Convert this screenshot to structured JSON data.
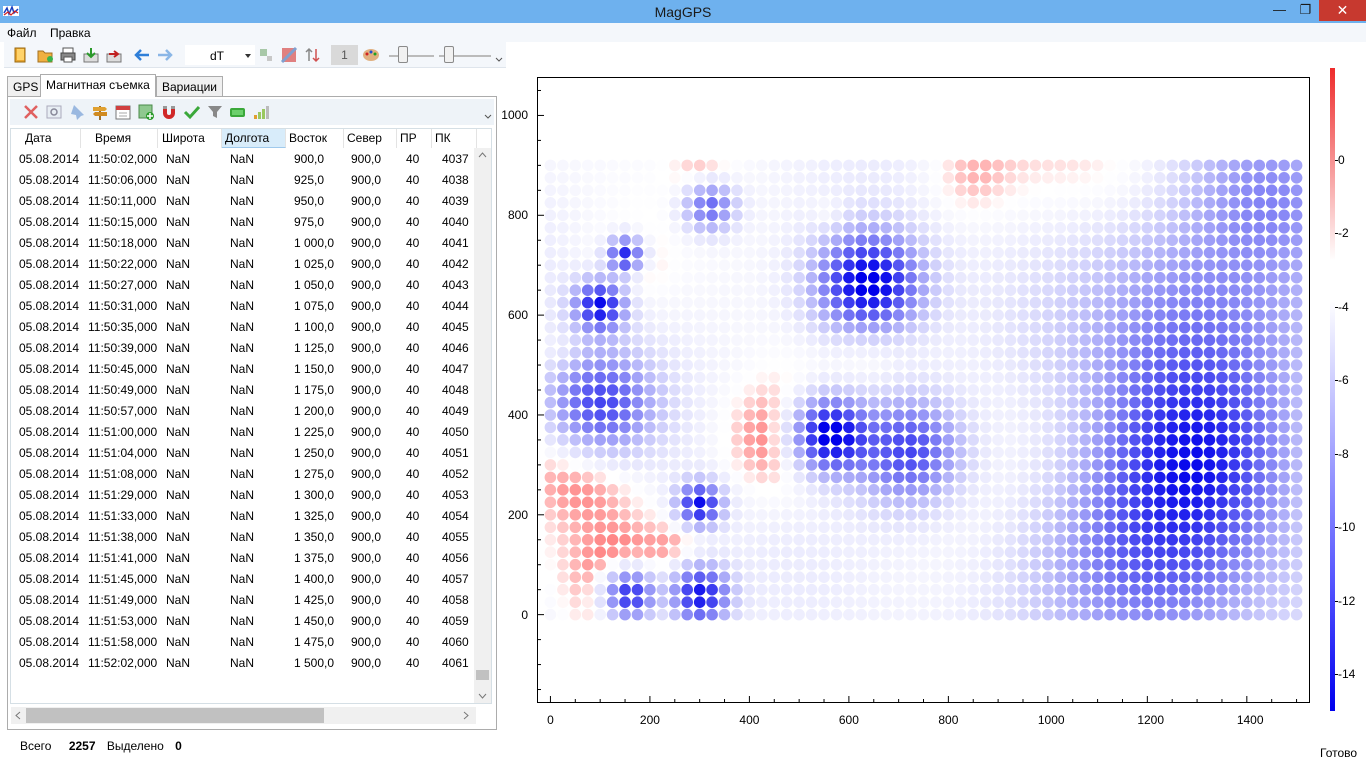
{
  "window": {
    "title": "MagGPS",
    "minimize_glyph": "—",
    "maximize_glyph": "❐",
    "close_glyph": "✕"
  },
  "menu": [
    "Файл",
    "Правка"
  ],
  "toolbar": {
    "channel_value": "dT",
    "number_value": "1"
  },
  "tabs": [
    "GPS",
    "Магнитная съемка",
    "Вариации"
  ],
  "table": {
    "columns": [
      "Дата",
      "Время",
      "Широта",
      "Долгота",
      "Восток",
      "Север",
      "ПР",
      "ПК"
    ],
    "rows": [
      [
        "05.08.2014",
        "11:50:02,000",
        "NaN",
        "NaN",
        "900,0",
        "900,0",
        "40",
        "4037"
      ],
      [
        "05.08.2014",
        "11:50:06,000",
        "NaN",
        "NaN",
        "925,0",
        "900,0",
        "40",
        "4038"
      ],
      [
        "05.08.2014",
        "11:50:11,000",
        "NaN",
        "NaN",
        "950,0",
        "900,0",
        "40",
        "4039"
      ],
      [
        "05.08.2014",
        "11:50:15,000",
        "NaN",
        "NaN",
        "975,0",
        "900,0",
        "40",
        "4040"
      ],
      [
        "05.08.2014",
        "11:50:18,000",
        "NaN",
        "NaN",
        "1 000,0",
        "900,0",
        "40",
        "4041"
      ],
      [
        "05.08.2014",
        "11:50:22,000",
        "NaN",
        "NaN",
        "1 025,0",
        "900,0",
        "40",
        "4042"
      ],
      [
        "05.08.2014",
        "11:50:27,000",
        "NaN",
        "NaN",
        "1 050,0",
        "900,0",
        "40",
        "4043"
      ],
      [
        "05.08.2014",
        "11:50:31,000",
        "NaN",
        "NaN",
        "1 075,0",
        "900,0",
        "40",
        "4044"
      ],
      [
        "05.08.2014",
        "11:50:35,000",
        "NaN",
        "NaN",
        "1 100,0",
        "900,0",
        "40",
        "4045"
      ],
      [
        "05.08.2014",
        "11:50:39,000",
        "NaN",
        "NaN",
        "1 125,0",
        "900,0",
        "40",
        "4046"
      ],
      [
        "05.08.2014",
        "11:50:45,000",
        "NaN",
        "NaN",
        "1 150,0",
        "900,0",
        "40",
        "4047"
      ],
      [
        "05.08.2014",
        "11:50:49,000",
        "NaN",
        "NaN",
        "1 175,0",
        "900,0",
        "40",
        "4048"
      ],
      [
        "05.08.2014",
        "11:50:57,000",
        "NaN",
        "NaN",
        "1 200,0",
        "900,0",
        "40",
        "4049"
      ],
      [
        "05.08.2014",
        "11:51:00,000",
        "NaN",
        "NaN",
        "1 225,0",
        "900,0",
        "40",
        "4050"
      ],
      [
        "05.08.2014",
        "11:51:04,000",
        "NaN",
        "NaN",
        "1 250,0",
        "900,0",
        "40",
        "4051"
      ],
      [
        "05.08.2014",
        "11:51:08,000",
        "NaN",
        "NaN",
        "1 275,0",
        "900,0",
        "40",
        "4052"
      ],
      [
        "05.08.2014",
        "11:51:29,000",
        "NaN",
        "NaN",
        "1 300,0",
        "900,0",
        "40",
        "4053"
      ],
      [
        "05.08.2014",
        "11:51:33,000",
        "NaN",
        "NaN",
        "1 325,0",
        "900,0",
        "40",
        "4054"
      ],
      [
        "05.08.2014",
        "11:51:38,000",
        "NaN",
        "NaN",
        "1 350,0",
        "900,0",
        "40",
        "4055"
      ],
      [
        "05.08.2014",
        "11:51:41,000",
        "NaN",
        "NaN",
        "1 375,0",
        "900,0",
        "40",
        "4056"
      ],
      [
        "05.08.2014",
        "11:51:45,000",
        "NaN",
        "NaN",
        "1 400,0",
        "900,0",
        "40",
        "4057"
      ],
      [
        "05.08.2014",
        "11:51:49,000",
        "NaN",
        "NaN",
        "1 425,0",
        "900,0",
        "40",
        "4058"
      ],
      [
        "05.08.2014",
        "11:51:53,000",
        "NaN",
        "NaN",
        "1 450,0",
        "900,0",
        "40",
        "4059"
      ],
      [
        "05.08.2014",
        "11:51:58,000",
        "NaN",
        "NaN",
        "1 475,0",
        "900,0",
        "40",
        "4060"
      ],
      [
        "05.08.2014",
        "11:52:02,000",
        "NaN",
        "NaN",
        "1 500,0",
        "900,0",
        "40",
        "4061"
      ]
    ]
  },
  "status": {
    "total_label": "Всего",
    "total_value": "2257",
    "selected_label": "Выделено",
    "selected_value": "0",
    "ready": "Готово"
  },
  "chart_data": {
    "type": "scatter",
    "title": "",
    "xlabel": "",
    "ylabel": "",
    "xlim": [
      -25,
      1525
    ],
    "ylim": [
      -175,
      1075
    ],
    "x_ticks": [
      0,
      200,
      400,
      600,
      800,
      1000,
      1200,
      1400
    ],
    "y_ticks": [
      0,
      200,
      400,
      600,
      800,
      1000
    ],
    "grid_spacing": 25,
    "grid_x_range": [
      0,
      1500
    ],
    "grid_y_range": [
      0,
      900
    ],
    "colorbar": {
      "ticks": [
        0,
        -2,
        -4,
        -6,
        -8,
        -10,
        -12,
        -14
      ],
      "range": [
        2.5,
        -15
      ]
    },
    "anomalies": [
      {
        "x": 75,
        "y": 300,
        "value": 2,
        "radius": 75
      },
      {
        "x": 460,
        "y": 350,
        "value": 2,
        "radius": 75
      },
      {
        "x": 640,
        "y": 560,
        "value": 2,
        "radius": 55
      },
      {
        "x": 310,
        "y": 870,
        "value": 1.5,
        "radius": 40
      },
      {
        "x": 150,
        "y": 700,
        "value": 1.5,
        "radius": 45
      },
      {
        "x": 150,
        "y": 80,
        "value": 1.5,
        "radius": 80
      },
      {
        "x": 270,
        "y": 150,
        "value": 1,
        "radius": 40
      },
      {
        "x": 20,
        "y": 525,
        "value": 1,
        "radius": 30
      },
      {
        "x": 840,
        "y": 880,
        "value": 1,
        "radius": 60
      },
      {
        "x": 1180,
        "y": 850,
        "value": 0.8,
        "radius": 90
      },
      {
        "x": 1000,
        "y": 800,
        "value": 0.6,
        "radius": 150
      },
      {
        "x": 1100,
        "y": 320,
        "value": 0.6,
        "radius": 120
      },
      {
        "x": 560,
        "y": 800,
        "value": 1,
        "radius": 25
      },
      {
        "x": 640,
        "y": 660,
        "value": -14,
        "radius": 70
      },
      {
        "x": 560,
        "y": 360,
        "value": -14,
        "radius": 50
      },
      {
        "x": 100,
        "y": 620,
        "value": -12,
        "radius": 35
      },
      {
        "x": 150,
        "y": 720,
        "value": -12,
        "radius": 25
      },
      {
        "x": 300,
        "y": 220,
        "value": -12,
        "radius": 30
      },
      {
        "x": 160,
        "y": 40,
        "value": -12,
        "radius": 35
      },
      {
        "x": 300,
        "y": 40,
        "value": -12,
        "radius": 40
      },
      {
        "x": 720,
        "y": 330,
        "value": -9,
        "radius": 70
      },
      {
        "x": 100,
        "y": 420,
        "value": -9,
        "radius": 70
      },
      {
        "x": 320,
        "y": 820,
        "value": -8,
        "radius": 35
      },
      {
        "x": 1300,
        "y": 320,
        "value": -8,
        "radius": 130
      },
      {
        "x": 1200,
        "y": 100,
        "value": -7,
        "radius": 150
      },
      {
        "x": 1300,
        "y": 600,
        "value": -6,
        "radius": 170
      },
      {
        "x": 1450,
        "y": 850,
        "value": -4,
        "radius": 100
      }
    ]
  }
}
